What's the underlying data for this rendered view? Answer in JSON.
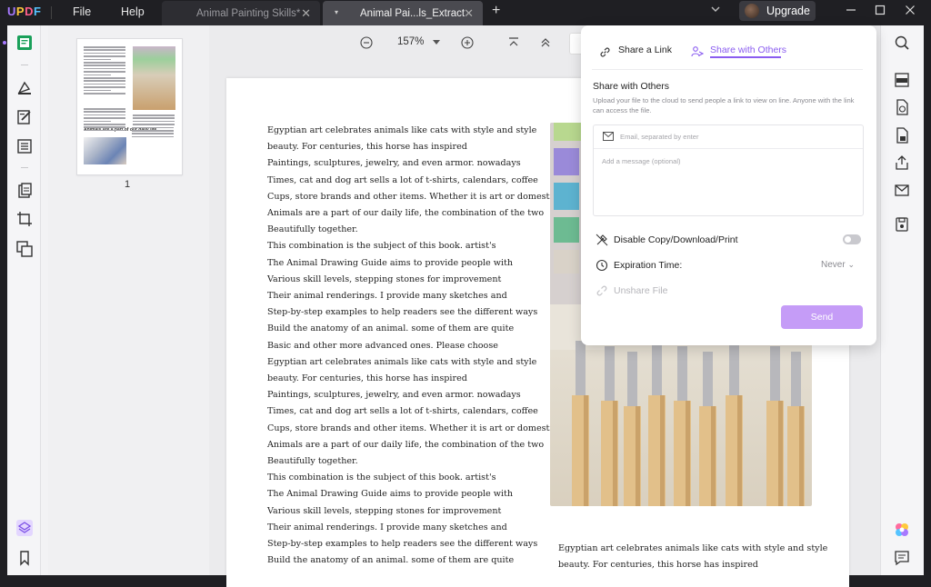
{
  "app": {
    "logo": "UPDF"
  },
  "menu": {
    "file": "File",
    "help": "Help"
  },
  "tabs": [
    {
      "label": "Animal Painting Skills*",
      "active": false
    },
    {
      "label": "Animal Pai...ls_Extract",
      "active": true
    }
  ],
  "upgrade": {
    "label": "Upgrade"
  },
  "toolbar": {
    "zoom": "157%"
  },
  "thumbnail": {
    "page_number": "1",
    "heading": "Animals are a part of our daily life"
  },
  "document": {
    "column1": [
      "Egyptian art celebrates animals like cats with style and style",
      "beauty. For centuries, this horse has inspired",
      "Paintings, sculptures, jewelry, and even armor. nowadays",
      "Times, cat and dog art sells a lot of t-shirts, calendars, coffee",
      "Cups, store brands and other items. Whether it is art or domestic",
      "Animals are a part of our daily life, the combination of the two",
      "Beautifully together.",
      "This combination is the subject of this book. artist's",
      "The Animal Drawing Guide aims to provide people with",
      "Various skill levels, stepping stones for improvement",
      "Their animal renderings. I provide many sketches and",
      "Step-by-step examples to help readers see the different ways",
      "Build the anatomy of an animal. some of them are quite",
      "Basic and other more advanced ones. Please choose",
      "Egyptian art celebrates animals like cats with style and style",
      "beauty. For centuries, this horse has inspired",
      "Paintings, sculptures, jewelry, and even armor. nowadays",
      "Times, cat and dog art sells a lot of t-shirts, calendars, coffee",
      "Cups, store brands and other items. Whether it is art or domestic",
      "Animals are a part of our daily life, the combination of the two",
      "Beautifully together.",
      "This combination is the subject of this book. artist's",
      "The Animal Drawing Guide aims to provide people with",
      "Various skill levels, stepping stones for improvement",
      "Their animal renderings. I provide many sketches and",
      "Step-by-step examples to help readers see the different ways",
      "Build the anatomy of an animal. some of them are quite"
    ],
    "column2": [
      "Egyptian art celebrates animals like cats with style and style",
      "beauty. For centuries, this horse has inspired"
    ]
  },
  "share_popup": {
    "tab_link": "Share a Link",
    "tab_others": "Share with Others",
    "title": "Share with Others",
    "description": "Upload your file to the cloud to send people a link to view on line. Anyone with the link can access the file.",
    "email_placeholder": "Email, separated by enter",
    "message_placeholder": "Add a message (optional)",
    "disable_label": "Disable Copy/Download/Print",
    "disable_enabled": false,
    "expiration_label": "Expiration Time:",
    "expiration_value": "Never",
    "unshare_label": "Unshare File",
    "send_label": "Send"
  },
  "colors": {
    "accent": "#8a5cf0",
    "send_button": "#c59cf7",
    "titlebar": "#1f1f23"
  }
}
